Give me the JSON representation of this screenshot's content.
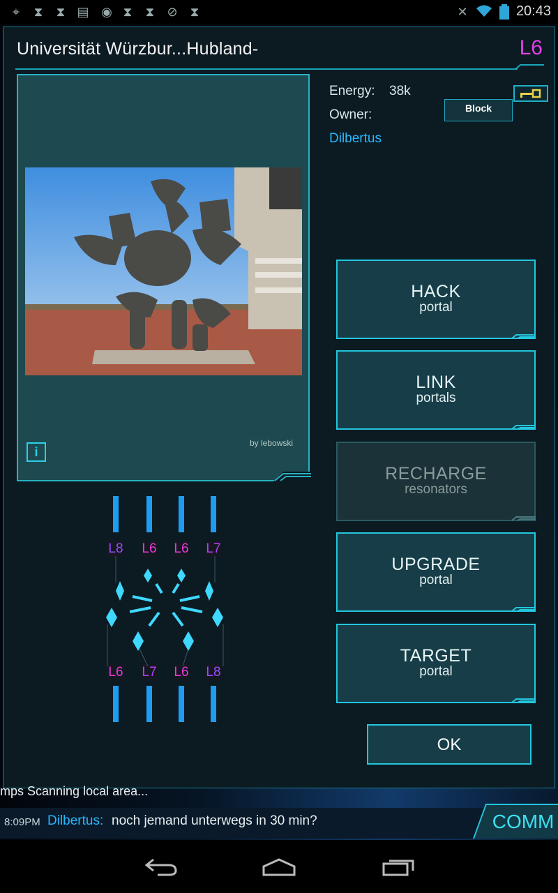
{
  "status_bar": {
    "time": "20:43",
    "icons": [
      "gps-icon",
      "hourglass-icon",
      "hourglass-icon",
      "chat-icon",
      "ingress-icon",
      "hourglass-icon",
      "hourglass-icon",
      "mute-icon",
      "hourglass-icon",
      "muted-icon",
      "wifi-icon",
      "battery-icon"
    ]
  },
  "portal": {
    "title": "Universität Würzbur...Hubland-",
    "level": "L6",
    "photo_credit": "by lebowski",
    "info_label": "i",
    "energy_label": "Energy:",
    "energy_value": "38k",
    "owner_label": "Owner:",
    "owner_name": "Dilbertus",
    "block_label": "Block"
  },
  "actions": [
    {
      "line1": "HACK",
      "line2": "portal",
      "enabled": true
    },
    {
      "line1": "LINK",
      "line2": "portals",
      "enabled": true
    },
    {
      "line1": "RECHARGE",
      "line2": "resonators",
      "enabled": false
    },
    {
      "line1": "UPGRADE",
      "line2": "portal",
      "enabled": true
    },
    {
      "line1": "TARGET",
      "line2": "portal",
      "enabled": true
    }
  ],
  "ok_label": "OK",
  "resonators": {
    "top": [
      "L8",
      "L6",
      "L6",
      "L7"
    ],
    "bottom": [
      "L6",
      "L7",
      "L6",
      "L8"
    ],
    "colors": {
      "L6": "#e83ad8",
      "L7": "#b640f0",
      "L8": "#9a4cff"
    }
  },
  "comm": {
    "scan_text": "mps  Scanning local area...",
    "time": "8:09PM",
    "user": "Dilbertus:",
    "message": "noch jemand unterwegs in 30 min?",
    "button_label": "COMM"
  },
  "colors": {
    "accent": "#23c6de",
    "level": "#e040e8",
    "owner": "#28b8ff"
  }
}
